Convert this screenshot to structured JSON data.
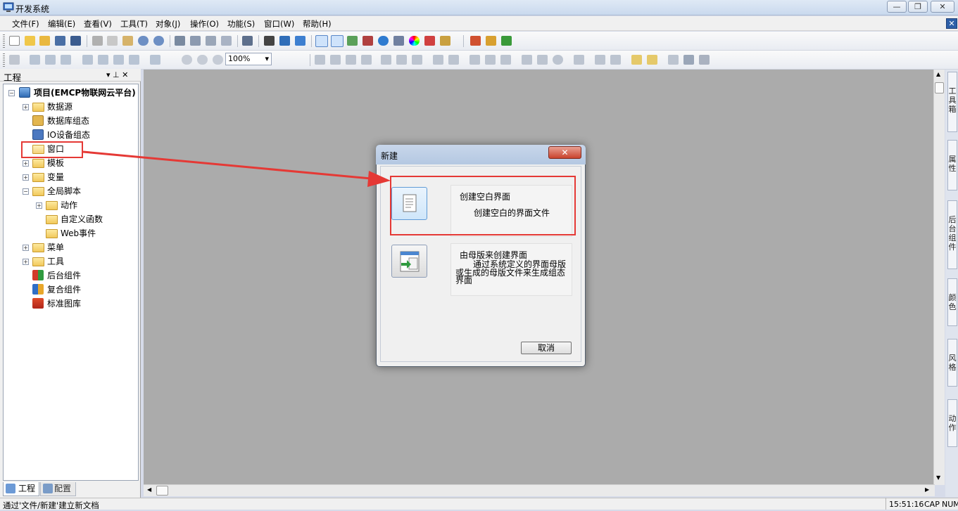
{
  "app": {
    "title": "开发系统"
  },
  "window_controls": {
    "minimize": "—",
    "restore": "❐",
    "close": "✕"
  },
  "menu": [
    "文件(F)",
    "编辑(E)",
    "查看(V)",
    "工具(T)",
    "对象(J)",
    "操作(O)",
    "功能(S)",
    "窗口(W)",
    "帮助(H)"
  ],
  "zoom": "100%",
  "panel": {
    "title": "工程",
    "pin": "▾ ⊥ ✕"
  },
  "tree": [
    {
      "label": "项目(EMCP物联网云平台)"
    },
    {
      "label": "数据源"
    },
    {
      "label": "数据库组态"
    },
    {
      "label": "IO设备组态"
    },
    {
      "label": "窗口"
    },
    {
      "label": "模板"
    },
    {
      "label": "变量"
    },
    {
      "label": "全局脚本"
    },
    {
      "label": "动作"
    },
    {
      "label": "自定义函数"
    },
    {
      "label": "Web事件"
    },
    {
      "label": "菜单"
    },
    {
      "label": "工具"
    },
    {
      "label": "后台组件"
    },
    {
      "label": "复合组件"
    },
    {
      "label": "标准图库"
    }
  ],
  "bottom_tabs": {
    "project": "工程",
    "config": "配置"
  },
  "right_tabs": [
    "工具箱",
    "属性",
    "后台组件",
    "颜色",
    "风格",
    "动作"
  ],
  "dialog": {
    "title": "新建",
    "close": "✕",
    "option1_title": "创建空白界面",
    "option1_desc": "创建空白的界面文件",
    "option2_title": "由母版来创建界面",
    "option2_desc_line1": "通过系统定义的界面母版",
    "option2_desc_line2": "或生成的母版文件来生成组态",
    "option2_desc_line3": "界面",
    "cancel": "取消"
  },
  "status": {
    "message": "通过'文件/新建'建立新文档",
    "time": "15:51:16",
    "cap": "CAP",
    "num": "NUM"
  },
  "colors": {
    "highlight": "#e53935",
    "mdi_background": "#ababab"
  }
}
